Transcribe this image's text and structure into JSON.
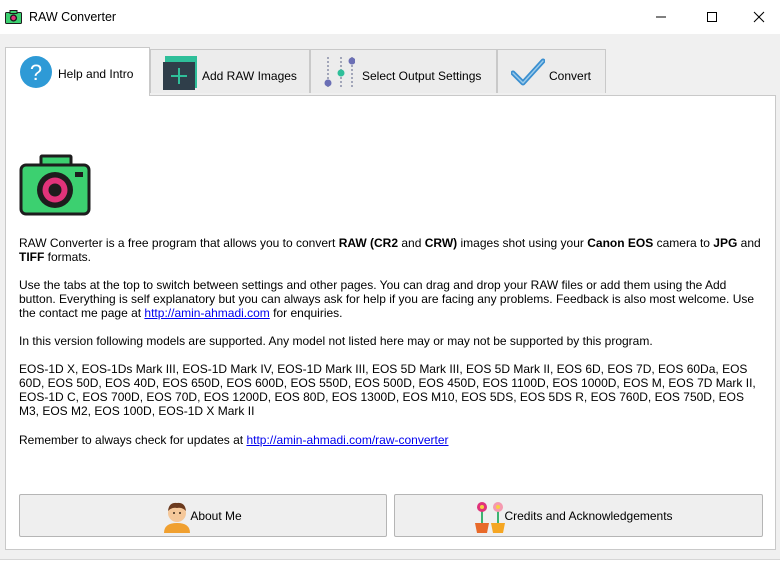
{
  "window": {
    "title": "RAW Converter",
    "icons": [
      "camera-icon",
      "minimize-icon",
      "maximize-icon",
      "close-icon"
    ]
  },
  "tabs": [
    {
      "label": "Help and Intro",
      "icon": "help-icon",
      "active": true
    },
    {
      "label": "Add RAW Images",
      "icon": "add-icon",
      "active": false
    },
    {
      "label": "Select Output Settings",
      "icon": "settings-sliders-icon",
      "active": false
    },
    {
      "label": "Convert",
      "icon": "checkmark-icon",
      "active": false
    }
  ],
  "intro": {
    "p1_a": "RAW Converter is a free program that allows you to convert ",
    "p1_b": "RAW (CR2",
    "p1_c": " and ",
    "p1_d": "CRW)",
    "p1_e": " images shot using your ",
    "p1_f": "Canon EOS",
    "p1_g": " camera to ",
    "p1_h": "JPG",
    "p1_i": " and ",
    "p1_j": "TIFF",
    "p1_k": " formats.",
    "p2": "Use the tabs at the top to switch between settings and other pages. You can drag and drop your RAW files or add them using the Add button. Everything is self explanatory but you can always ask for help if you are facing any problems. Feedback is also most welcome. Use the contact me page at ",
    "p2_link": "http://amin-ahmadi.com",
    "p2_end": " for enquiries.",
    "p3": "In this version following models are supported. Any model not listed here may or may not be supported by this program.",
    "models": "EOS-1D X, EOS-1Ds Mark III, EOS-1D Mark IV, EOS-1D Mark III, EOS 5D Mark III, EOS 5D Mark II, EOS 6D, EOS 7D, EOS 60Da, EOS 60D, EOS 50D, EOS 40D, EOS 650D, EOS 600D, EOS 550D, EOS 500D, EOS 450D, EOS 1100D, EOS 1000D, EOS M, EOS 7D Mark II, EOS-1D C, EOS 700D, EOS 70D, EOS 1200D, EOS 80D, EOS 1300D, EOS M10, EOS 5DS, EOS 5DS R, EOS 760D, EOS 750D, EOS M3, EOS M2, EOS 100D, EOS-1D X Mark II",
    "p4": "Remember to always check for updates at ",
    "p4_link": "http://amin-ahmadi.com/raw-converter"
  },
  "buttons": {
    "about": {
      "label": "About Me",
      "icon": "person-avatar-icon"
    },
    "credits": {
      "label": "Credits and Acknowledgements",
      "icon": "flower-pots-icon"
    }
  },
  "colors": {
    "camera_body": "#3cd070",
    "camera_lens": "#e0337a",
    "help_icon": "#2e9ad6",
    "add_icon_bg": "#2f3e4a",
    "add_icon_accent": "#2fbf9a",
    "check_icon": "#3a8fd0"
  }
}
